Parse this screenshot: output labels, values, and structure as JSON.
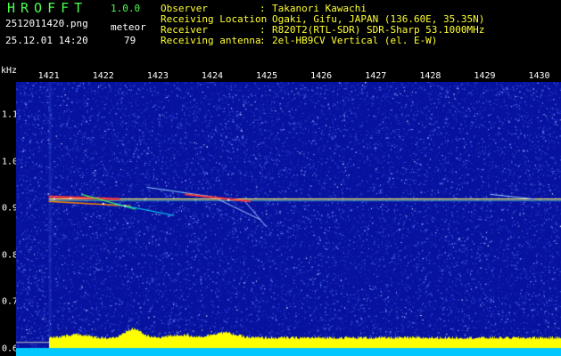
{
  "header": {
    "app_title": "HROFFT",
    "app_version": "1.0.0",
    "file_name": "2512011420.png",
    "timestamp": "25.12.01 14:20",
    "meteor_label": "meteor",
    "meteor_count": "79"
  },
  "info": [
    {
      "label": "Observer",
      "colon": ":",
      "value": "Takanori Kawachi"
    },
    {
      "label": "Receiving Location",
      "colon": ":",
      "value": "Ogaki, Gifu, JAPAN (136.60E, 35.35N)"
    },
    {
      "label": "Receiver",
      "colon": ":",
      "value": "R820T2(RTL-SDR) SDR-Sharp 53.1000MHz"
    },
    {
      "label": "Receiving antenna",
      "colon": ":",
      "value": "2el-HB9CV Vertical (el. E-W)"
    }
  ],
  "spectrogram": {
    "unit_label": "kHz",
    "x_ticks": [
      "1421",
      "1422",
      "1423",
      "1424",
      "1425",
      "1426",
      "1427",
      "1428",
      "1429",
      "1430"
    ],
    "y_ticks": [
      "1.1",
      "1.0",
      "0.9",
      "0.8",
      "0.7",
      "0.6"
    ],
    "x_range": [
      1420.4,
      1430.4
    ],
    "y_range": [
      0.585,
      1.17
    ],
    "carrier_khz": 0.92,
    "colors": {
      "background": "#07129e",
      "noise": "#3c56d8",
      "carrier": "#ffff66",
      "echo": "#ff4444",
      "baseline_bar": "#ffff00",
      "bottom_strip": "#00c8ff",
      "ref_line": "#c8c8c8"
    }
  }
}
